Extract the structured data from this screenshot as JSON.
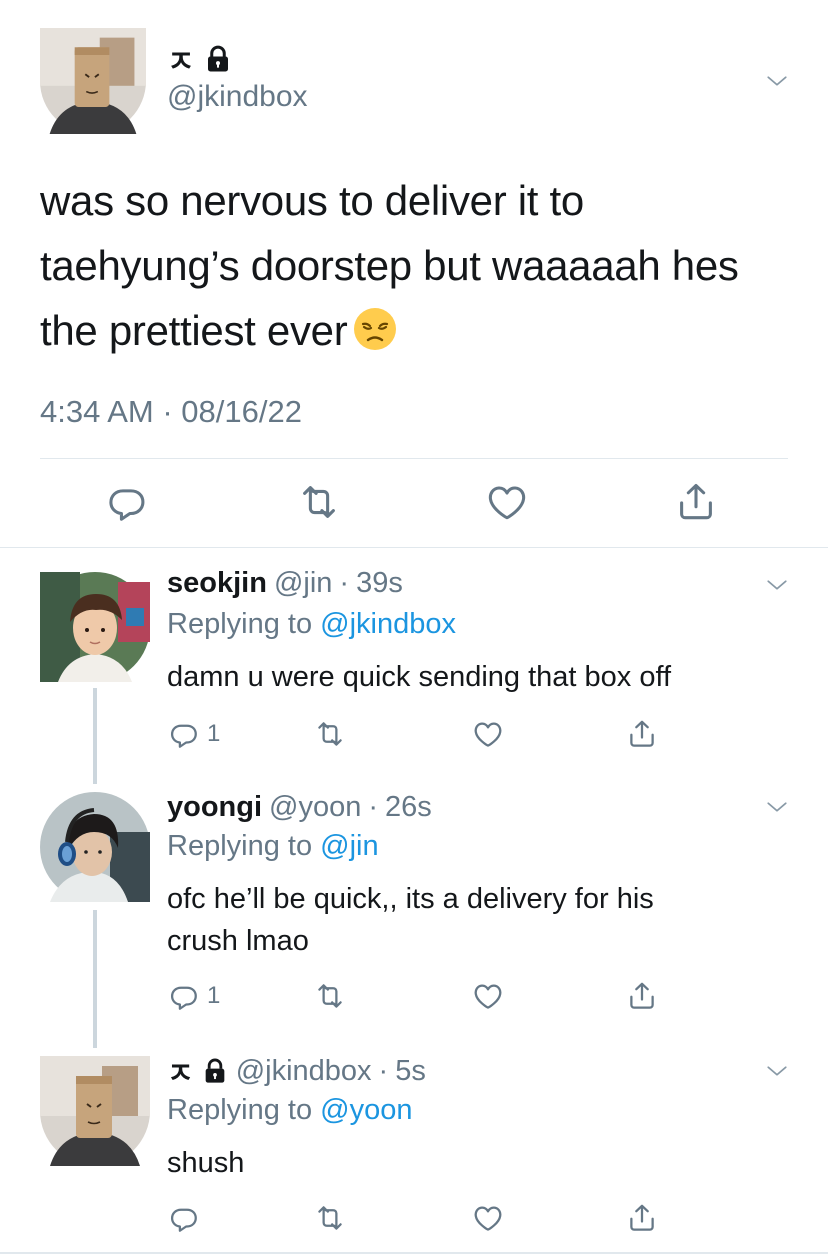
{
  "main_tweet": {
    "name": "ㅈ",
    "handle": "@jkindbox",
    "text_line1": "was so nervous to deliver it to",
    "text_line2": "taehyung’s doorstep but waaaaah hes",
    "text_line3": "the prettiest ever",
    "emoji": "disappointed-face",
    "timestamp": "4:34 AM · 08/16/22"
  },
  "replies": [
    {
      "name": "seokjin",
      "handle": "@jin",
      "dot": "·",
      "time": "39s",
      "replying_prefix": "Replying to",
      "replying_to": "@jkindbox",
      "body": "damn u were quick sending that box off",
      "reply_count": "1"
    },
    {
      "name": "yoongi",
      "handle": "@yoon",
      "dot": "·",
      "time": "26s",
      "replying_prefix": "Replying to",
      "replying_to": "@jin",
      "body": "ofc he’ll be quick,, its a delivery for his crush lmao",
      "reply_count": "1"
    },
    {
      "name": "ㅈ",
      "handle": "@jkindbox",
      "dot": "·",
      "time": "5s",
      "replying_prefix": "Replying to",
      "replying_to": "@yoon",
      "body": "shush",
      "reply_count": ""
    }
  ],
  "colors": {
    "text": "#14171a",
    "secondary": "#657786",
    "link": "#1b95e0",
    "divider": "#e1e8ed"
  }
}
